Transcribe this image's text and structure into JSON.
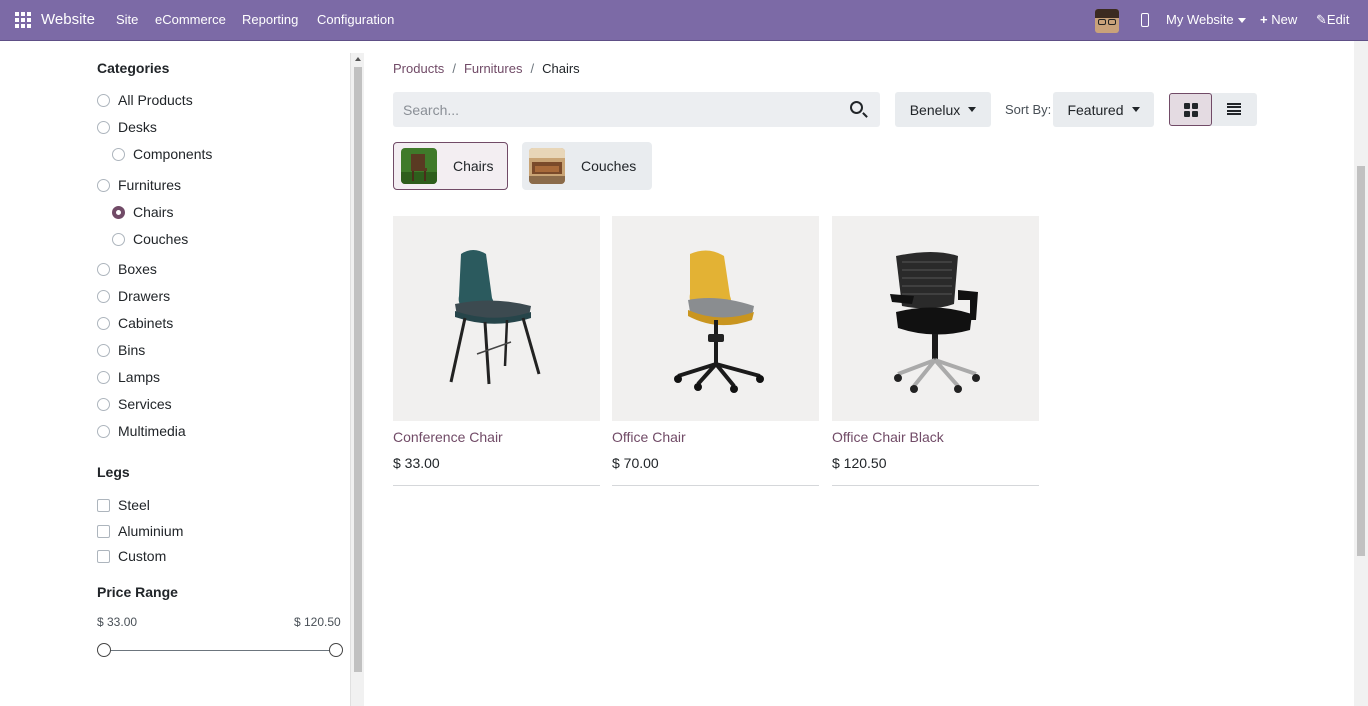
{
  "topbar": {
    "brand": "Website",
    "menus": [
      "Site",
      "eCommerce",
      "Reporting",
      "Configuration"
    ],
    "website_selector": "My Website",
    "new_label": "New",
    "edit_label": "Edit"
  },
  "sidebar": {
    "categories_title": "Categories",
    "categories": [
      {
        "label": "All Products",
        "checked": false
      },
      {
        "label": "Desks",
        "checked": false
      },
      {
        "label": "Components",
        "checked": false
      },
      {
        "label": "Furnitures",
        "checked": false
      },
      {
        "label": "Chairs",
        "checked": true
      },
      {
        "label": "Couches",
        "checked": false
      },
      {
        "label": "Boxes",
        "checked": false
      },
      {
        "label": "Drawers",
        "checked": false
      },
      {
        "label": "Cabinets",
        "checked": false
      },
      {
        "label": "Bins",
        "checked": false
      },
      {
        "label": "Lamps",
        "checked": false
      },
      {
        "label": "Services",
        "checked": false
      },
      {
        "label": "Multimedia",
        "checked": false
      }
    ],
    "legs_title": "Legs",
    "legs": [
      "Steel",
      "Aluminium",
      "Custom"
    ],
    "price_title": "Price Range",
    "price_min": "$ 33.00",
    "price_max": "$ 120.50"
  },
  "breadcrumb": {
    "items": [
      "Products",
      "Furnitures"
    ],
    "current": "Chairs",
    "separator": "/"
  },
  "search": {
    "placeholder": "Search..."
  },
  "pricelist": "Benelux",
  "sort": {
    "label": "Sort By:",
    "value": "Featured"
  },
  "subcategories": [
    "Chairs",
    "Couches"
  ],
  "products": [
    {
      "name": "Conference Chair",
      "price": "$ 33.00"
    },
    {
      "name": "Office Chair",
      "price": "$ 70.00"
    },
    {
      "name": "Office Chair Black",
      "price": "$ 120.50"
    }
  ],
  "colors": {
    "topbar": "#7c6aa6",
    "accent": "#714b67"
  }
}
